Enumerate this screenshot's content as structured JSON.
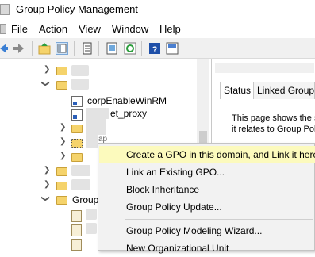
{
  "window": {
    "title": "Group Policy Management"
  },
  "menu": {
    "file": "File",
    "action": "Action",
    "view": "View",
    "window": "Window",
    "help": "Help"
  },
  "tree": {
    "item_winrm": "corpEnableWinRM",
    "item_proxy": "et_proxy",
    "item_group_partial": "Group",
    "item_partial_1": "ap"
  },
  "details": {
    "tab_status": "Status",
    "tab_linked": "Linked Group P",
    "line1": "This page shows the s",
    "line2": "it relates to Group Polic"
  },
  "context_menu": {
    "create_gpo": "Create a GPO in this domain, and Link it here...",
    "link_existing": "Link an Existing GPO...",
    "block_inheritance": "Block Inheritance",
    "gp_update": "Group Policy Update...",
    "modeling_wizard": "Group Policy Modeling Wizard...",
    "new_ou": "New Organizational Unit"
  }
}
